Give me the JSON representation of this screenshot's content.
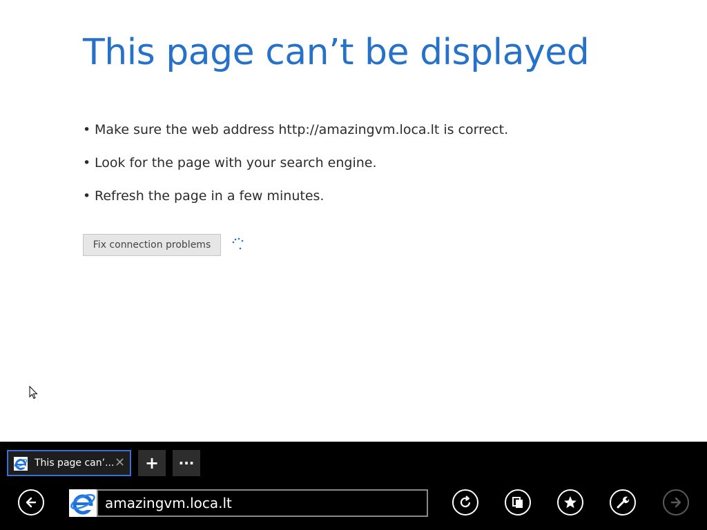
{
  "page": {
    "title": "This page can’t be displayed",
    "bullets": [
      "Make sure the web address http://amazingvm.loca.lt is correct.",
      "Look for the page with your search engine.",
      "Refresh the page in a few minutes."
    ],
    "bullet_char": "•",
    "fix_button_label": "Fix connection problems",
    "accent_color": "#2672c9"
  },
  "appbar": {
    "tab": {
      "label": "This page can’...",
      "close": "✕",
      "icon": "ie-logo-icon"
    },
    "new_tab_label": "+",
    "tab_tools_label": "···",
    "address": {
      "value": "amazingvm.loca.lt",
      "icon": "ie-logo-icon"
    },
    "buttons": [
      "back-icon",
      "refresh-icon",
      "pin-icon",
      "favorites-icon",
      "tools-icon",
      "forward-icon"
    ],
    "tab_border_color": "#3a6fd8"
  }
}
